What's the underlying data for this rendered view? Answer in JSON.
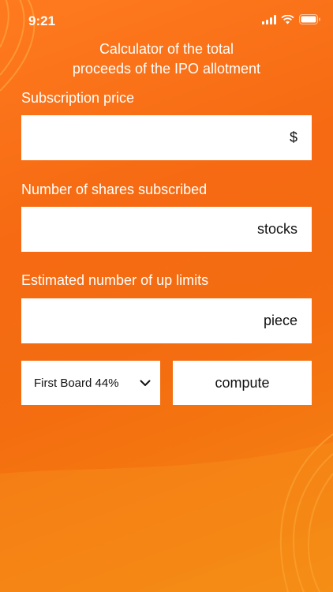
{
  "status": {
    "time": "9:21"
  },
  "title": {
    "line1": "Calculator of the total",
    "line2": "proceeds of the IPO allotment"
  },
  "fields": [
    {
      "label": "Subscription price",
      "value": "",
      "unit": "$"
    },
    {
      "label": "Number of shares subscribed",
      "value": "",
      "unit": "stocks"
    },
    {
      "label": "Estimated number of up limits",
      "value": "",
      "unit": "piece"
    }
  ],
  "board_select": {
    "selected": "First Board 44%"
  },
  "compute_button": {
    "label": "compute"
  },
  "icons": {
    "signal": "signal-icon",
    "wifi": "wifi-icon",
    "battery": "battery-icon",
    "dropdown": "chevron-down-icon"
  },
  "colors": {
    "background": "#f56a12",
    "field": "#ffffff",
    "text": "#111111"
  }
}
